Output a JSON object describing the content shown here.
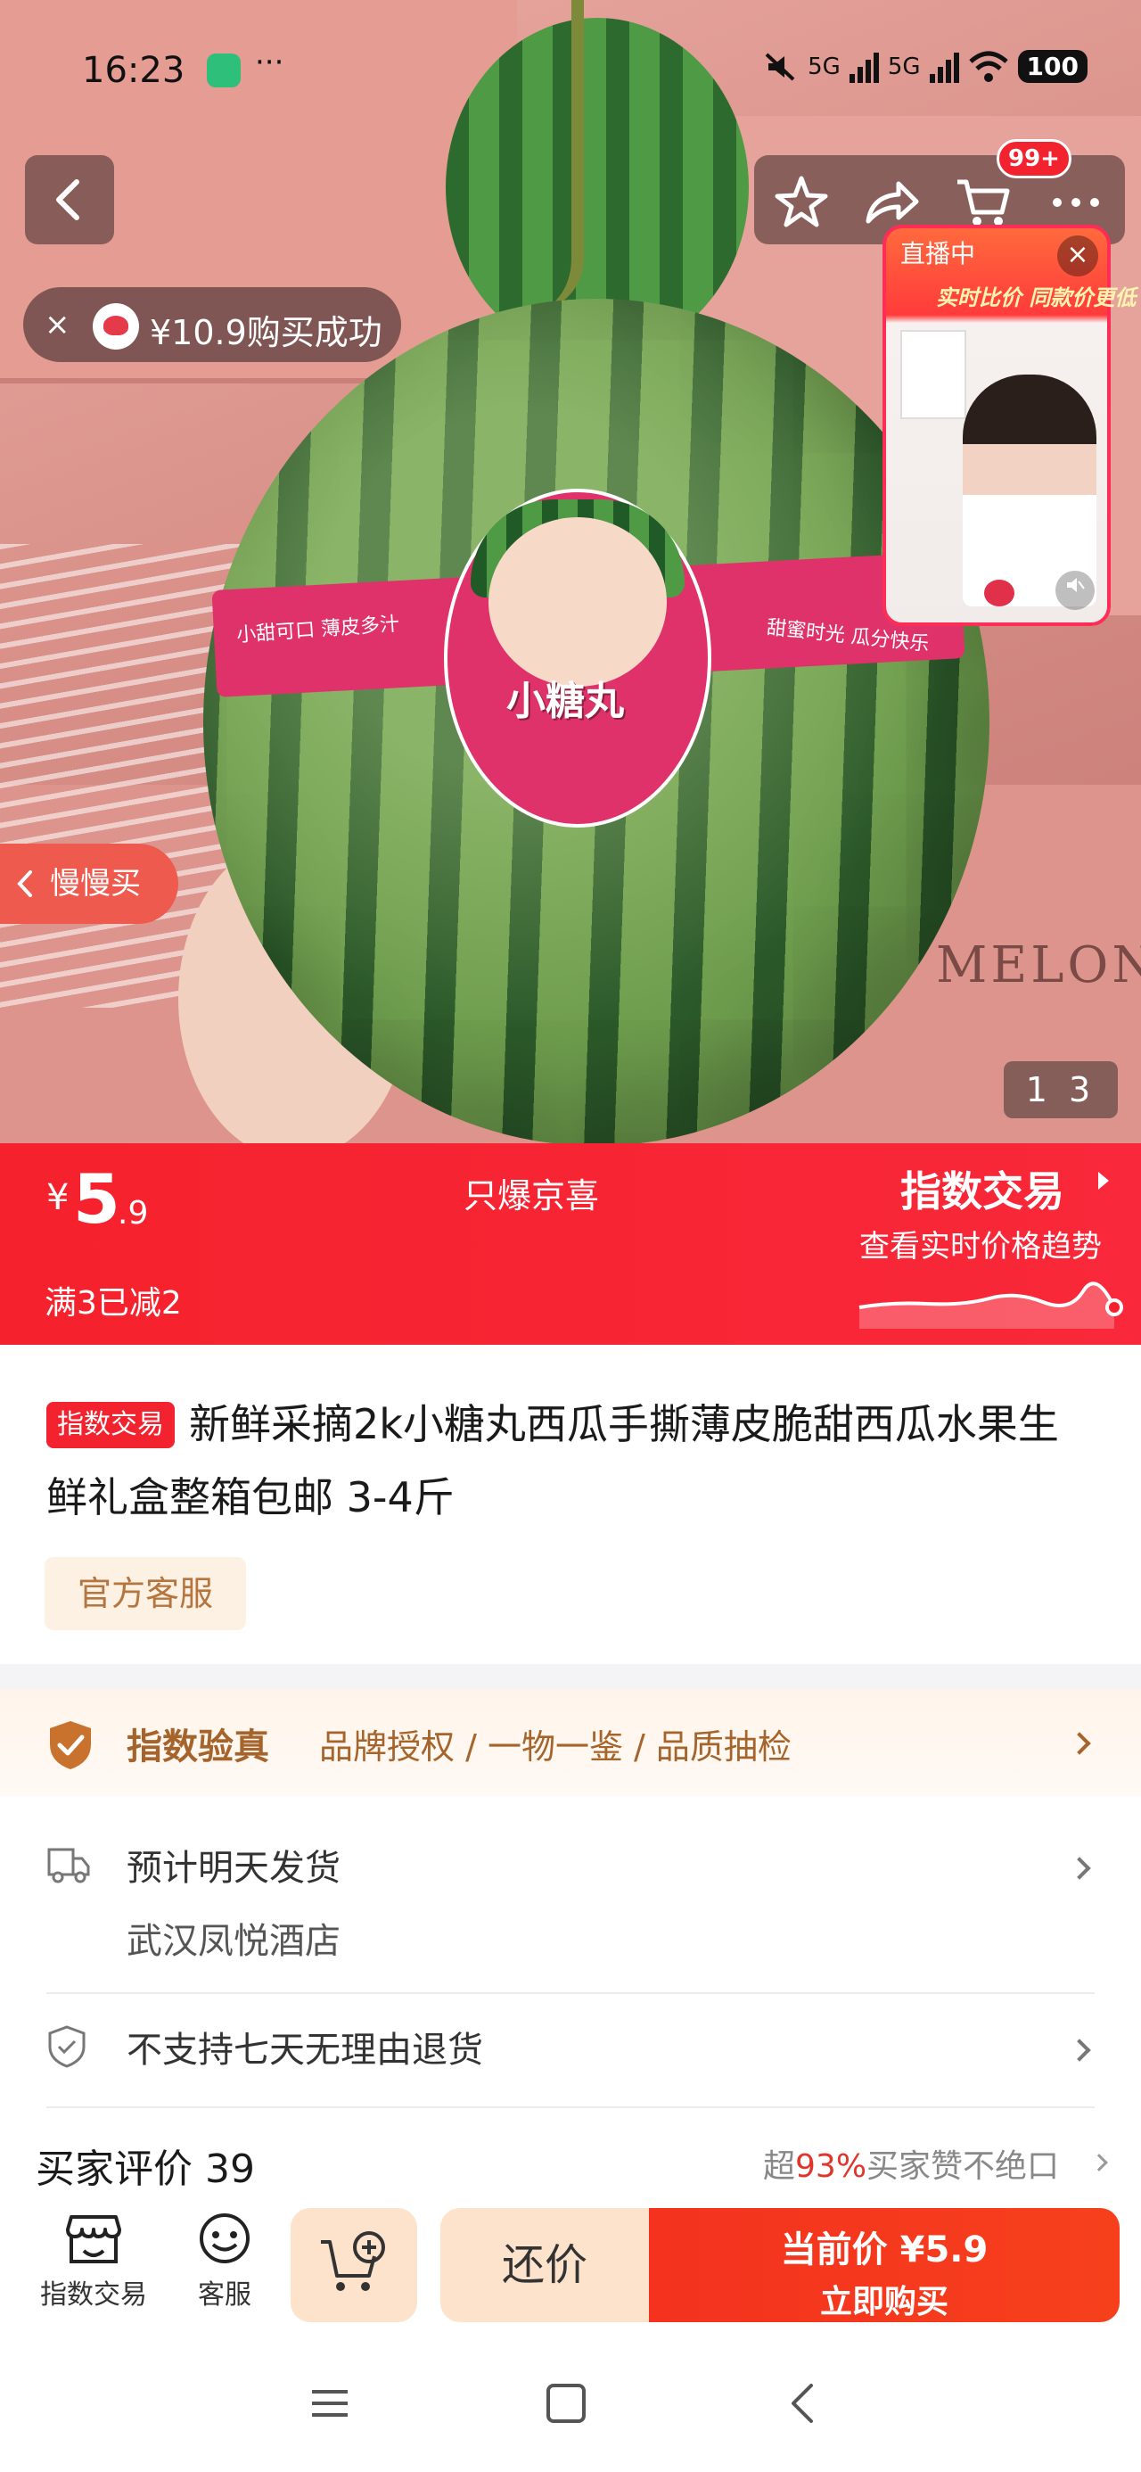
{
  "status_bar": {
    "time": "16:23",
    "dots": "···",
    "net1": "5G",
    "net2": "5G",
    "battery": "100"
  },
  "nav": {
    "cart_badge": "99+"
  },
  "toast": {
    "close": "×",
    "text": "¥10.9购买成功"
  },
  "live": {
    "tag": "直播中",
    "close": "×",
    "promo": "实时比价 同款价更低"
  },
  "hero": {
    "slow_buy": "慢慢买",
    "label_name": "小糖丸",
    "band_left": "小甜可口 薄皮多汁",
    "band_right": "甜蜜时光 瓜分快乐",
    "bg_text": "MELON",
    "counter": "1 3"
  },
  "price_bar": {
    "currency": "¥",
    "price_int": "5",
    "price_dec": ".9",
    "deal": "满3已减2",
    "center": "只爆京喜",
    "index_title": "指数交易",
    "trend": "查看实时价格趋势"
  },
  "product": {
    "tag": "指数交易",
    "title": "新鲜采摘2k小糖丸西瓜手撕薄皮脆甜西瓜水果生鲜礼盒整箱包邮 3-4斤",
    "customer_service": "官方客服"
  },
  "verify": {
    "title": "指数验真",
    "items": "品牌授权 / 一物一鉴 / 品质抽检"
  },
  "shipping": {
    "line1": "预计明天发货",
    "line2": "武汉凤悦酒店"
  },
  "returns": {
    "text": "不支持七天无理由退货"
  },
  "reviews": {
    "title": "买家评价 39",
    "summary_prefix": "超",
    "summary_pct": "93%",
    "summary_suffix": "买家赞不绝口"
  },
  "bottom_bar": {
    "index_label": "指数交易",
    "service_label": "客服",
    "bargain": "还价",
    "buy_price": "当前价 ¥5.9",
    "buy_label": "立即购买"
  },
  "colors": {
    "brand_red": "#f5222d",
    "gold": "#a5642b",
    "peach": "#fde3cc"
  }
}
